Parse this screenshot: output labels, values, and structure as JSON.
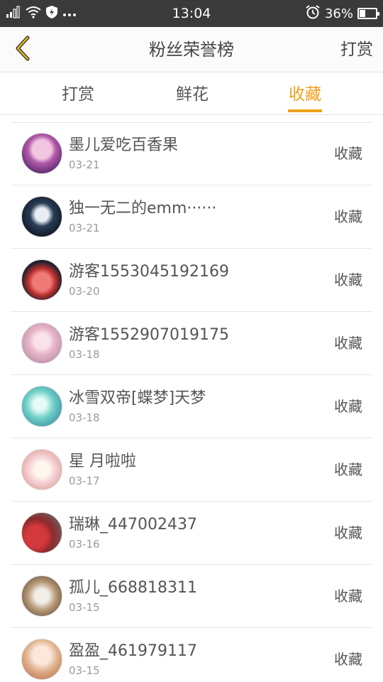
{
  "status_bar": {
    "time": "13:04",
    "battery_text": "36%",
    "battery_level": 0.36,
    "icons": [
      "signal-icon",
      "wifi-icon",
      "shield-icon",
      "more-icon",
      "alarm-icon",
      "battery-icon"
    ]
  },
  "header": {
    "title": "粉丝荣誉榜",
    "right_link": "打赏"
  },
  "tabs": [
    {
      "label": "打赏",
      "active": false
    },
    {
      "label": "鲜花",
      "active": false
    },
    {
      "label": "收藏",
      "active": true
    }
  ],
  "colors": {
    "accent": "#f0a11a",
    "status_bar": "#3a3a3a",
    "text": "#555555",
    "subtext": "#9a9a9a"
  },
  "fans": [
    {
      "name": "墨儿爱吃百香果",
      "date": "03-21",
      "action": "收藏"
    },
    {
      "name": "独一无二的emm······",
      "date": "03-21",
      "action": "收藏"
    },
    {
      "name": "游客1553045192169",
      "date": "03-20",
      "action": "收藏"
    },
    {
      "name": "游客1552907019175",
      "date": "03-18",
      "action": "收藏"
    },
    {
      "name": "冰雪双帝[蝶梦]天梦",
      "date": "03-18",
      "action": "收藏"
    },
    {
      "name": "星 月啦啦",
      "date": "03-17",
      "action": "收藏"
    },
    {
      "name": "瑞琳_447002437",
      "date": "03-16",
      "action": "收藏"
    },
    {
      "name": "孤儿_668818311",
      "date": "03-15",
      "action": "收藏"
    },
    {
      "name": "盈盈_461979117",
      "date": "03-15",
      "action": "收藏"
    }
  ]
}
